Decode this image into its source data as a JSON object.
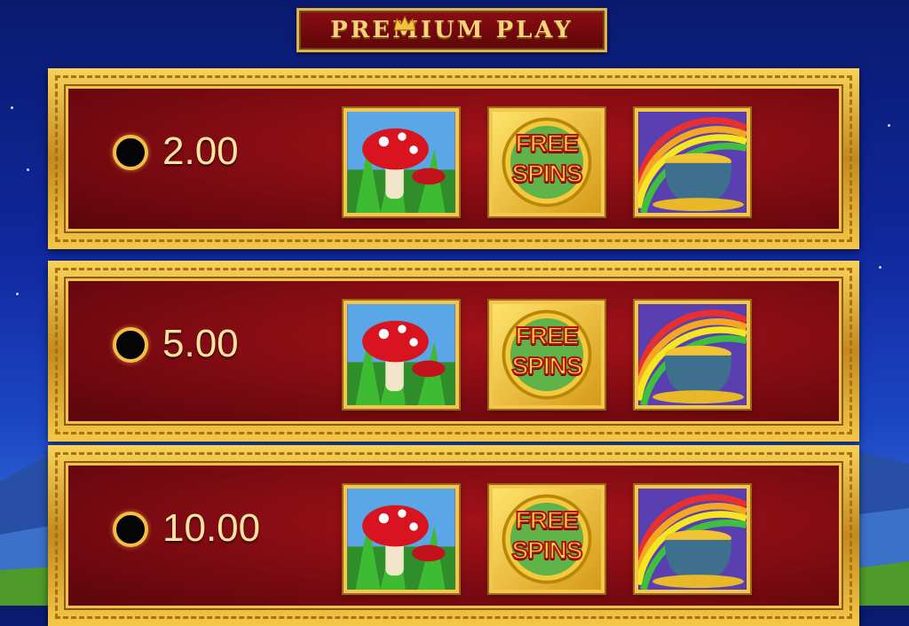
{
  "title": "PREMIUM PLAY",
  "rows": [
    {
      "amount": "2.00",
      "selected": false,
      "symbols": [
        "mushroom-icon",
        "free-spins-icon",
        "pot-of-gold-icon"
      ]
    },
    {
      "amount": "5.00",
      "selected": false,
      "symbols": [
        "mushroom-icon",
        "free-spins-icon",
        "pot-of-gold-icon"
      ]
    },
    {
      "amount": "10.00",
      "selected": false,
      "symbols": [
        "mushroom-icon",
        "free-spins-icon",
        "pot-of-gold-icon"
      ]
    }
  ],
  "free_spins_line1": "FREE",
  "free_spins_line2": "SPINS",
  "colors": {
    "gold": "#f4c64e",
    "red": "#8c0d14",
    "amount": "#fbe3a2"
  }
}
